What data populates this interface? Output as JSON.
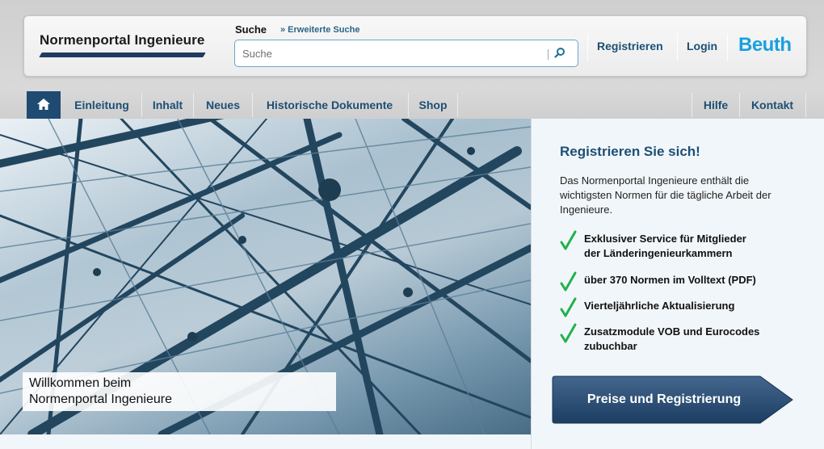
{
  "header": {
    "logo_text": "Normenportal Ingenieure",
    "search_label": "Suche",
    "advanced_search": "» Erweiterte Suche",
    "search_placeholder": "Suche",
    "register_link": "Registrieren",
    "login_link": "Login",
    "brand": "Beuth"
  },
  "nav": {
    "items": [
      {
        "label": "Einleitung"
      },
      {
        "label": "Inhalt"
      },
      {
        "label": "Neues"
      },
      {
        "label": "Historische Dokumente"
      },
      {
        "label": "Shop"
      },
      {
        "label": "Hilfe"
      },
      {
        "label": "Kontakt"
      }
    ]
  },
  "hero": {
    "welcome_line1": "Willkommen beim",
    "welcome_line2": "Normenportal Ingenieure"
  },
  "panel": {
    "title": "Registrieren Sie sich!",
    "intro": "Das Normenportal Ingenieure enthält die wichtigsten Normen für die tägliche Arbeit der Ingenieure.",
    "benefits": [
      {
        "line1": "Exklusiver Service für Mitglieder",
        "line2": "der Länderingenieurkammern"
      },
      {
        "line1": "über 370 Normen im Volltext (PDF)",
        "line2": ""
      },
      {
        "line1": "Vierteljährliche Aktualisierung",
        "line2": ""
      },
      {
        "line1": "Zusatzmodule VOB und Eurocodes",
        "line2": "zubuchbar"
      }
    ],
    "cta_label": "Preise und Registrierung"
  },
  "colors": {
    "accent": "#1d4f74",
    "brand": "#1aa0df",
    "check": "#22b14c",
    "nav_home_bg": "#1f4a72"
  },
  "icons": {
    "search": "magnifier-icon",
    "home": "home-icon",
    "check": "checkmark-icon"
  }
}
